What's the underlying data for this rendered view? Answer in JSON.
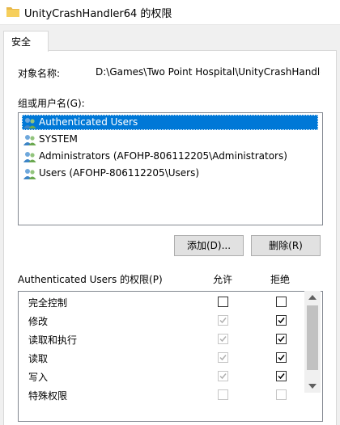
{
  "window": {
    "title": "UnityCrashHandler64 的权限"
  },
  "tabs": [
    {
      "label": "安全"
    }
  ],
  "object": {
    "label": "对象名称:",
    "value": "D:\\Games\\Two Point Hospital\\UnityCrashHandle"
  },
  "groups": {
    "label": "组或用户名(G):",
    "items": [
      {
        "name": "Authenticated Users",
        "selected": true
      },
      {
        "name": "SYSTEM",
        "selected": false
      },
      {
        "name": "Administrators (AFOHP-806112205\\Administrators)",
        "selected": false
      },
      {
        "name": "Users (AFOHP-806112205\\Users)",
        "selected": false
      }
    ]
  },
  "buttons": {
    "add": "添加(D)...",
    "remove": "删除(R)"
  },
  "permissions": {
    "label": "Authenticated Users 的权限(P)",
    "allow_header": "允许",
    "deny_header": "拒绝",
    "rows": [
      {
        "name": "完全控制",
        "allow": "unchecked",
        "deny": "unchecked"
      },
      {
        "name": "修改",
        "allow": "checked-disabled",
        "deny": "checked"
      },
      {
        "name": "读取和执行",
        "allow": "checked-disabled",
        "deny": "checked"
      },
      {
        "name": "读取",
        "allow": "checked-disabled",
        "deny": "checked"
      },
      {
        "name": "写入",
        "allow": "checked-disabled",
        "deny": "checked"
      },
      {
        "name": "特殊权限",
        "allow": "unchecked-disabled",
        "deny": "unchecked-disabled"
      }
    ]
  },
  "colors": {
    "selection": "#0078d7",
    "panel": "#ffffff",
    "window_bg": "#f0f0f0"
  }
}
